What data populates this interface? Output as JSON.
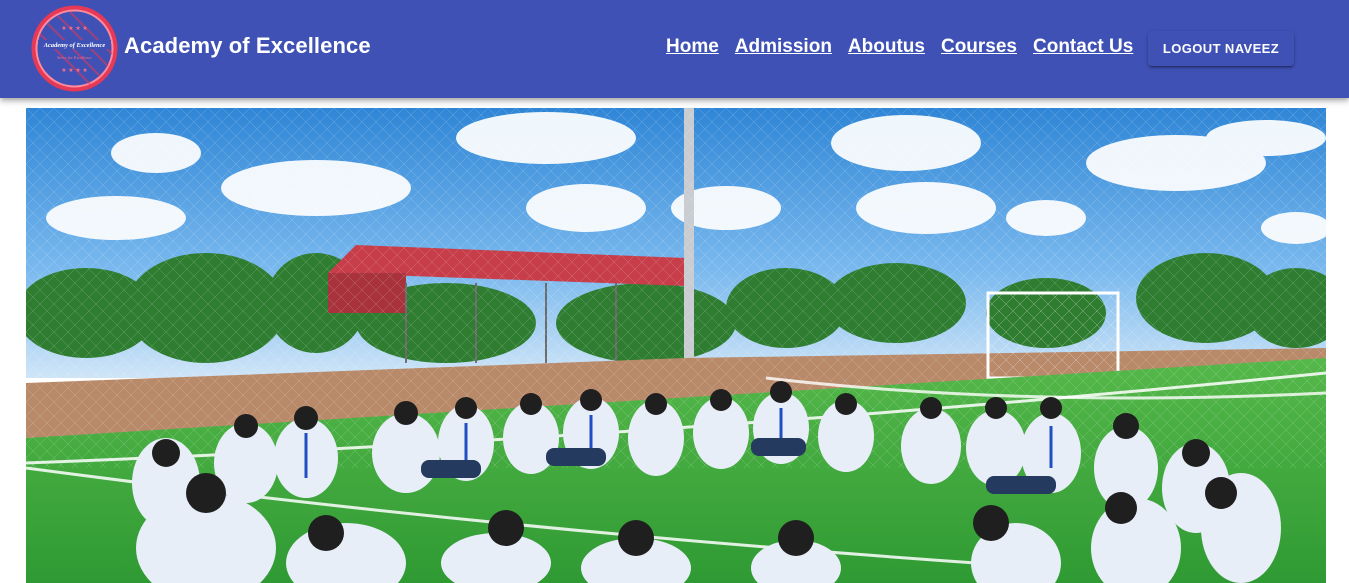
{
  "brand": {
    "title": "Academy of Excellence",
    "logo_text_top": "Academy of Excellence",
    "logo_text_bottom": "Strive for Excellence",
    "logo_stars": "★ ★ ★ ★"
  },
  "nav": {
    "items": [
      {
        "label": "Home"
      },
      {
        "label": "Admission"
      },
      {
        "label": "Aboutus"
      },
      {
        "label": "Courses"
      },
      {
        "label": "Contact Us"
      }
    ]
  },
  "account": {
    "logout_label": "LOGOUT NAVEEZ"
  },
  "colors": {
    "appbar": "#3f51b5",
    "logo_ring": "#e53956",
    "sky": "#4f9be0",
    "grass": "#3faa3c",
    "roof": "#c73e4a"
  },
  "hero": {
    "image_subject": "students-sitting-in-circle-on-football-field"
  }
}
